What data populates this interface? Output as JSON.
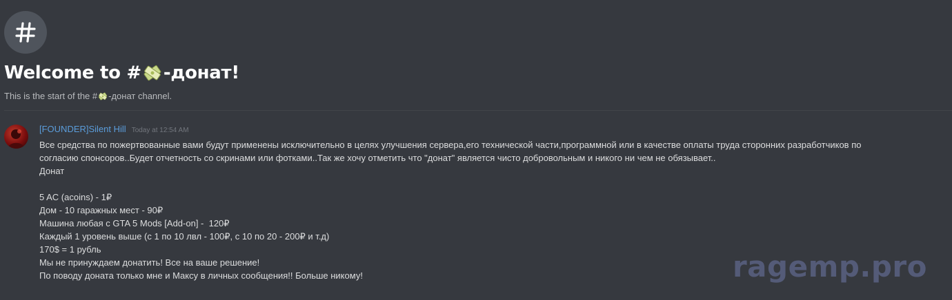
{
  "channel": {
    "hash_symbol": "#",
    "welcome_prefix": "Welcome to #",
    "welcome_suffix": "-донат!",
    "emoji": "money-emoji",
    "start_prefix": "This is the start of the #",
    "start_suffix": "-донат channel."
  },
  "message": {
    "username": "[FOUNDER]Silent Hill",
    "timestamp": "Today at 12:54 AM",
    "lines": [
      "Все средства по пожертвованные вами будут применены исключительно в целях улучшения сервера,его технической части,программной или в качестве оплаты труда сторонних разработчиков по",
      "согласию спонсоров..Будет отчетность со скринами или фотками..Так же хочу отметить что \"донат\" является чисто добровольным и никого ни чем не обязывает..",
      "Донат",
      "",
      "5 AC (acoins) - 1₽",
      "Дом - 10 гаражных мест - 90₽",
      "Машина любая с GTA 5 Mods [Add-on] -  120₽",
      "Каждый 1 уровень выше (с 1 по 10 лвл - 100₽, с 10 по 20 - 200₽ и т.д)",
      "170$ = 1 рубль",
      "Мы не принуждаем донатить! Все на ваше решение!",
      "По поводу доната только мне и Максу в личных сообщения!! Больше никому!"
    ]
  },
  "watermark": "ragemp.pro",
  "colors": {
    "background": "#36393f",
    "username": "#5b9ddb",
    "watermark": "#5a6283"
  }
}
